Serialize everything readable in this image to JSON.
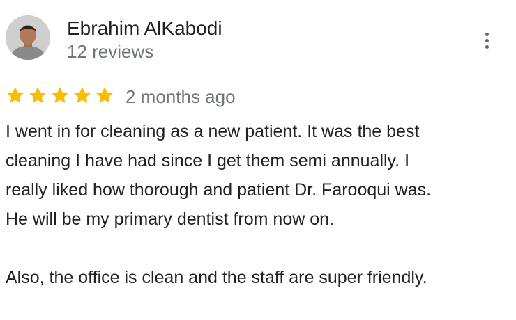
{
  "review": {
    "author": {
      "name": "Ebrahim AlKabodi",
      "reviews_count": "12 reviews",
      "avatar_icon": "person-avatar-icon"
    },
    "more_icon": "more-vert-icon",
    "rating": 5,
    "rating_max": 5,
    "star_color": "#fbbc04",
    "date": "2 months ago",
    "text_lines": [
      "I went in for cleaning as a new patient. It was the best",
      "cleaning I have had since I get them semi annually. I",
      "really liked how thorough and patient Dr. Farooqui was.",
      "He will be my primary dentist from now on.",
      "",
      "Also, the office is clean and the staff are super friendly."
    ]
  }
}
